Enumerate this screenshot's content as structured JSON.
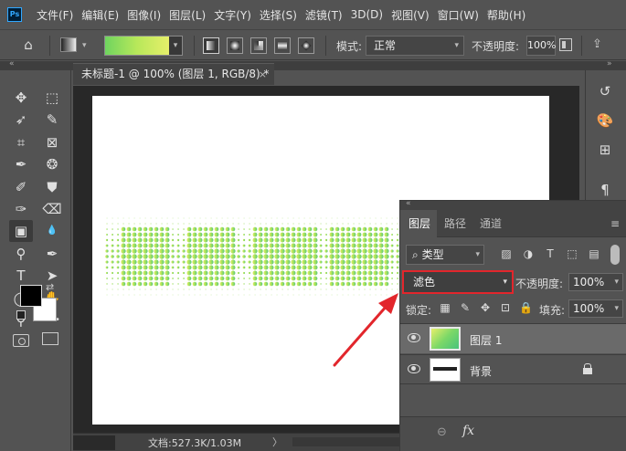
{
  "app": {
    "logo_text": "Ps"
  },
  "menu": [
    "文件(F)",
    "编辑(E)",
    "图像(I)",
    "图层(L)",
    "文字(Y)",
    "选择(S)",
    "滤镜(T)",
    "3D(D)",
    "视图(V)",
    "窗口(W)",
    "帮助(H)"
  ],
  "options_bar": {
    "home_icon": "⌂",
    "mode_label": "模式:",
    "mode_value": "正常",
    "opacity_label": "不透明度:",
    "opacity_value": "100%",
    "gradient_colors": [
      "#6fd45f",
      "#b8e85a",
      "#e6ef6a"
    ]
  },
  "document": {
    "tab_title": "未标题-1 @ 100% (图层 1, RGB/8) *",
    "close_icon": "×"
  },
  "status": {
    "doc_size": "文档:527.3K/1.03M",
    "arrow": "〉"
  },
  "layers_panel": {
    "tabs": [
      "图层",
      "路径",
      "通道"
    ],
    "menu_icon": "≡",
    "filter": {
      "label": "类型",
      "search_icon": "⌕"
    },
    "blend_mode": "滤色",
    "opacity_label": "不透明度:",
    "opacity_value": "100%",
    "lock_label": "锁定:",
    "fill_label": "填充:",
    "fill_value": "100%",
    "layers": [
      {
        "name": "图层 1",
        "selected": true
      },
      {
        "name": "背景",
        "locked": true
      }
    ],
    "bottom": {
      "link_icon": "⊖",
      "fx_label": "fx"
    }
  },
  "tools": [
    {
      "name": "move-tool-icon",
      "glyph": "✥"
    },
    {
      "name": "marquee-tool-icon",
      "glyph": "⬚"
    },
    {
      "name": "lasso-tool-icon",
      "glyph": "➶"
    },
    {
      "name": "quick-select-tool-icon",
      "glyph": "✎"
    },
    {
      "name": "crop-tool-icon",
      "glyph": "⌗"
    },
    {
      "name": "frame-tool-icon",
      "glyph": "⊠"
    },
    {
      "name": "eyedropper-tool-icon",
      "glyph": "✒"
    },
    {
      "name": "healing-tool-icon",
      "glyph": "❂"
    },
    {
      "name": "brush-tool-icon",
      "glyph": "✐"
    },
    {
      "name": "stamp-tool-icon",
      "glyph": "⛊"
    },
    {
      "name": "history-brush-tool-icon",
      "glyph": "✑"
    },
    {
      "name": "eraser-tool-icon",
      "glyph": "⌫"
    },
    {
      "name": "gradient-tool-icon",
      "glyph": "▣"
    },
    {
      "name": "blur-tool-icon",
      "glyph": "💧"
    },
    {
      "name": "dodge-tool-icon",
      "glyph": "⚲"
    },
    {
      "name": "pen-tool-icon",
      "glyph": "✒"
    },
    {
      "name": "type-tool-icon",
      "glyph": "T"
    },
    {
      "name": "path-select-tool-icon",
      "glyph": "➤"
    },
    {
      "name": "ellipse-tool-icon",
      "glyph": "◯"
    },
    {
      "name": "hand-tool-icon",
      "glyph": "✋"
    },
    {
      "name": "zoom-tool-icon",
      "glyph": "⚲"
    },
    {
      "name": "more-tools-icon",
      "glyph": "•••"
    }
  ],
  "right_strip": [
    {
      "name": "history-panel-icon",
      "glyph": "↺"
    },
    {
      "name": "swatches-panel-icon",
      "glyph": "🎨"
    },
    {
      "name": "grid-panel-icon",
      "glyph": "⊞"
    },
    {
      "name": "paragraph-panel-icon",
      "glyph": "¶"
    }
  ],
  "colors": {
    "accent_red": "#e2262c",
    "canvas_bg": "#ffffff",
    "ui_bg": "#535353"
  }
}
